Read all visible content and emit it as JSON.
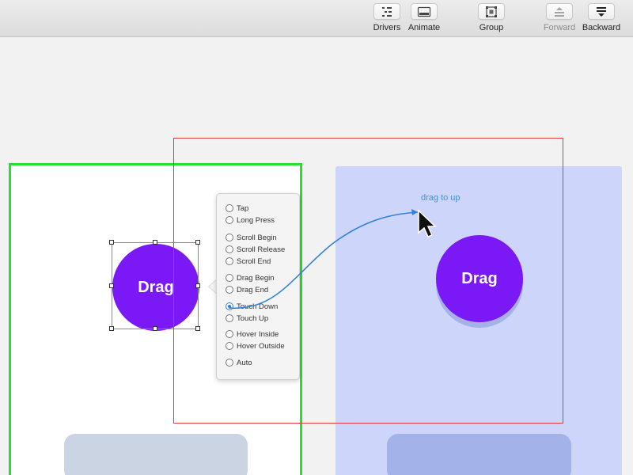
{
  "toolbar": {
    "buttons": [
      {
        "label": "Drivers",
        "icon": "drivers-icon",
        "enabled": true
      },
      {
        "label": "Animate",
        "icon": "animate-icon",
        "enabled": true
      },
      {
        "label": "Group",
        "icon": "group-icon",
        "enabled": true
      },
      {
        "label": "Forward",
        "icon": "forward-icon",
        "enabled": false
      },
      {
        "label": "Backward",
        "icon": "backward-icon",
        "enabled": true
      }
    ]
  },
  "canvas": {
    "left_layer": {
      "label": "Drag"
    },
    "right_layer": {
      "label": "Drag"
    },
    "hint": "drag to up"
  },
  "trigger_menu": {
    "options": [
      {
        "label": "Tap",
        "selected": false
      },
      {
        "label": "Long Press",
        "selected": false
      },
      {
        "label": "Scroll Begin",
        "selected": false
      },
      {
        "label": "Scroll Release",
        "selected": false
      },
      {
        "label": "Scroll End",
        "selected": false
      },
      {
        "label": "Drag Begin",
        "selected": false
      },
      {
        "label": "Drag End",
        "selected": false
      },
      {
        "label": "Touch Down",
        "selected": true
      },
      {
        "label": "Touch Up",
        "selected": false
      },
      {
        "label": "Hover Inside",
        "selected": false
      },
      {
        "label": "Hover Outside",
        "selected": false
      },
      {
        "label": "Auto",
        "selected": false
      }
    ]
  },
  "colors": {
    "accent_purple": "#7b19f6",
    "selection_green": "#22e32a",
    "frame_red": "#e23b3b",
    "connector_blue": "#2f80d8"
  }
}
